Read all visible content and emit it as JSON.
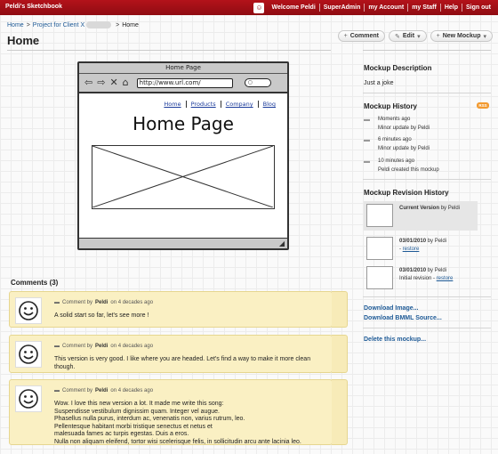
{
  "app": {
    "name": "Peldi's Sketchbook"
  },
  "topnav": {
    "welcome": "Welcome Peldi",
    "items": [
      "SuperAdmin",
      "my Account",
      "my Staff",
      "Help",
      "Sign out"
    ]
  },
  "breadcrumb": {
    "home": "Home",
    "project": "Project for Client X",
    "current": "Home"
  },
  "page": {
    "title": "Home"
  },
  "toolbar": {
    "comment": "Comment",
    "edit": "Edit",
    "new_mockup": "New Mockup"
  },
  "mockup": {
    "window_title": "Home Page",
    "url": "http://www.url.com/",
    "links": [
      "Home",
      "Products",
      "Company",
      "Blog"
    ],
    "heading": "Home Page"
  },
  "comments": {
    "title": "Comments (3)",
    "items": [
      {
        "meta_prefix": "Comment by",
        "author": "Peldi",
        "meta_suffix": "on 4 decades ago",
        "text": "A solid start so far, let's see more !"
      },
      {
        "meta_prefix": "Comment by",
        "author": "Peldi",
        "meta_suffix": "on 4 decades ago",
        "text": "This version is very good. I like where you are headed. Let's find a way to make it more clean though."
      },
      {
        "meta_prefix": "Comment by",
        "author": "Peldi",
        "meta_suffix": "on 4 decades ago",
        "text": "Wow. I love this new version a lot. It made me write this song:\nSuspendisse vestibulum dignissim quam. Integer vel augue.\nPhasellus nulla purus, interdum ac, venenatis non, varius rutrum, leo.\nPellentesque habitant morbi tristique senectus et netus et\nmalesuada fames ac turpis egestas. Duis a eros.\nNulla non aliquam eleifend, tortor wisi scelerisque felis, in sollicitudin arcu ante lacinia leo."
      }
    ]
  },
  "sidebar": {
    "description_title": "Mockup Description",
    "description": "Just a joke",
    "history_title": "Mockup History",
    "rss": "RSS",
    "history": [
      {
        "time": "Moments ago",
        "text": "Minor update by Peldi"
      },
      {
        "time": "6 minutes ago",
        "text": "Minor update by Peldi"
      },
      {
        "time": "10 minutes ago",
        "text": "Peldi created this mockup"
      }
    ],
    "revision_title": "Mockup Revision History",
    "revisions": [
      {
        "line1_bold": "Current Version",
        "line1_rest": "by Peldi",
        "line2": "",
        "restore": ""
      },
      {
        "line1_bold": "03/01/2010",
        "line1_rest": "by Peldi",
        "line2": "-",
        "restore": "restore"
      },
      {
        "line1_bold": "03/01/2010",
        "line1_rest": "by Peldi",
        "line2": "Initial revision -",
        "restore": "restore"
      }
    ],
    "download_image": "Download Image...",
    "download_bmml": "Download BMML Source...",
    "delete": "Delete this mockup..."
  }
}
